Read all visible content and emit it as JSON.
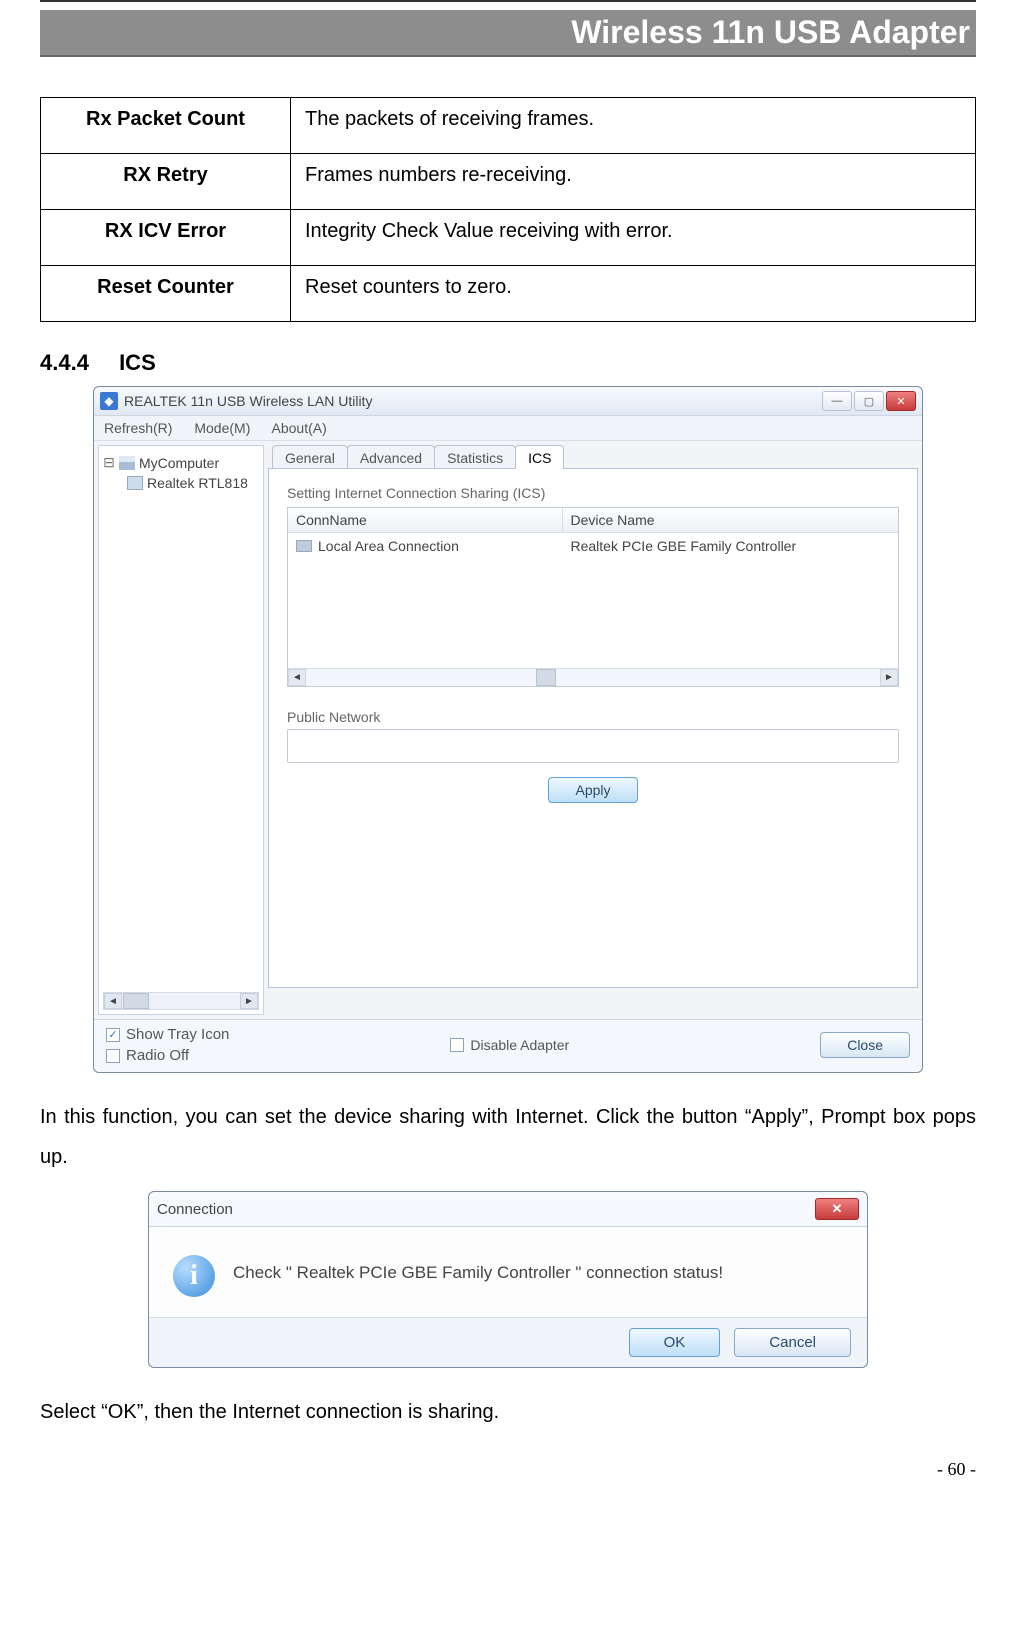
{
  "doc_header": "Wireless 11n USB Adapter",
  "def_table": [
    {
      "term": "Rx Packet Count",
      "desc": "The packets of receiving frames."
    },
    {
      "term": "RX Retry",
      "desc": "Frames numbers re-receiving."
    },
    {
      "term": "RX ICV Error",
      "desc": "Integrity Check Value receiving with error."
    },
    {
      "term": "Reset Counter",
      "desc": "Reset counters to zero."
    }
  ],
  "section_number": "4.4.4",
  "section_title": "ICS",
  "win1": {
    "title": "REALTEK 11n USB Wireless LAN Utility",
    "menus": {
      "refresh": "Refresh(R)",
      "mode": "Mode(M)",
      "about": "About(A)"
    },
    "tree": {
      "root": "MyComputer",
      "child": "Realtek RTL818"
    },
    "tabs": [
      "General",
      "Advanced",
      "Statistics",
      "ICS"
    ],
    "active_tab": "ICS",
    "group_label": "Setting Internet Connection Sharing (ICS)",
    "list_header": {
      "a": "ConnName",
      "b": "Device Name"
    },
    "list_row": {
      "a": "Local Area Connection",
      "b": "Realtek PCIe GBE Family Controller"
    },
    "public_label": "Public Network",
    "apply": "Apply",
    "show_tray": "Show Tray Icon",
    "radio_off": "Radio Off",
    "disable_adapter": "Disable Adapter",
    "close": "Close"
  },
  "para1": "In this function, you can set the device sharing with Internet. Click the button “Apply”, Prompt box pops up.",
  "win2": {
    "title": "Connection",
    "message": "Check \" Realtek PCIe GBE Family Controller \" connection status!",
    "ok": "OK",
    "cancel": "Cancel"
  },
  "para2": "Select “OK”, then the Internet connection is sharing.",
  "page_number": "- 60 -"
}
